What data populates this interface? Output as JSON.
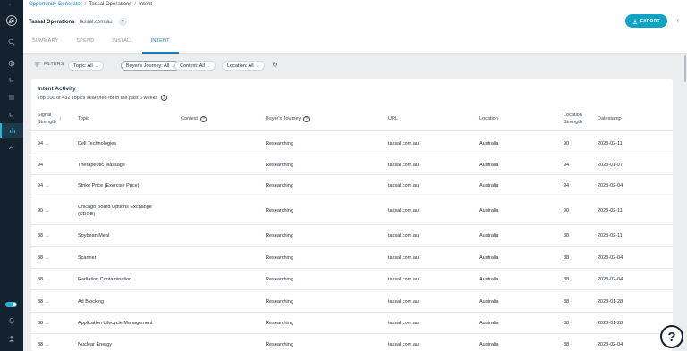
{
  "breadcrumb": {
    "root": "Opportunity Generator",
    "mid": "Tassal Operations",
    "current": "Intent"
  },
  "company": {
    "name": "Tassal Operations",
    "domain": "tassal.com.au",
    "help": "?"
  },
  "export_label": "EXPORT",
  "tabs": [
    {
      "label": "SUMMARY",
      "active": false
    },
    {
      "label": "SPEND",
      "active": false
    },
    {
      "label": "INSTALL",
      "active": false
    },
    {
      "label": "INTENT",
      "active": true
    }
  ],
  "filters": {
    "label": "FILTERS",
    "topic": "Topic: All",
    "journey": "Buyer's Journey: All",
    "context": "Context: All",
    "location": "Location: All"
  },
  "intent": {
    "title": "Intent Activity",
    "subtitle": "Top 100 of 432 Topics searched for in the past 6 weeks",
    "columns": {
      "signal": "Signal\nStrength",
      "topic": "Topic",
      "context": "Context",
      "journey": "Buyer's Journey",
      "url": "URL",
      "location": "Location",
      "loc_strength": "Location\nStrength",
      "date": "Datestamp"
    },
    "rows": [
      {
        "signal": "94",
        "arrow": "→",
        "topic": "Dell Technologies",
        "context": "",
        "journey": "Researching",
        "url": "tassal.com.au",
        "location": "Australia",
        "loc_strength": "90",
        "date": "2023-02-11"
      },
      {
        "signal": "94",
        "arrow": "",
        "topic": "Therapeutic Massage",
        "context": "",
        "journey": "Researching",
        "url": "tassal.com.au",
        "location": "Australia",
        "loc_strength": "94",
        "date": "2023-01-07"
      },
      {
        "signal": "94",
        "arrow": "→",
        "topic": "Strike Price (Exercise Price)",
        "context": "",
        "journey": "Researching",
        "url": "tassal.com.au",
        "location": "Australia",
        "loc_strength": "94",
        "date": "2023-02-04"
      },
      {
        "signal": "90",
        "arrow": "→",
        "topic": "Chicago Board Options Exchange\n(CBOE)",
        "context": "",
        "journey": "Researching",
        "url": "tassal.com.au",
        "location": "Australia",
        "loc_strength": "90",
        "date": "2023-02-11"
      },
      {
        "signal": "88",
        "arrow": "→",
        "topic": "Soybean Meal",
        "context": "",
        "journey": "Researching",
        "url": "tassal.com.au",
        "location": "Australia",
        "loc_strength": "88",
        "date": "2023-02-11"
      },
      {
        "signal": "88",
        "arrow": "→",
        "topic": "Scanner",
        "context": "",
        "journey": "Researching",
        "url": "tassal.com.au",
        "location": "Australia",
        "loc_strength": "88",
        "date": "2023-02-04"
      },
      {
        "signal": "88",
        "arrow": "→",
        "topic": "Radiation Contamination",
        "context": "",
        "journey": "Researching",
        "url": "tassal.com.au",
        "location": "Australia",
        "loc_strength": "88",
        "date": "2023-02-04"
      },
      {
        "signal": "88",
        "arrow": "→",
        "topic": "Ad Blocking",
        "context": "",
        "journey": "Researching",
        "url": "tassal.com.au",
        "location": "Australia",
        "loc_strength": "88",
        "date": "2023-01-28"
      },
      {
        "signal": "88",
        "arrow": "→",
        "topic": "Application Lifecycle Management",
        "context": "",
        "journey": "Researching",
        "url": "tassal.com.au",
        "location": "Australia",
        "loc_strength": "88",
        "date": "2023-01-28"
      },
      {
        "signal": "88",
        "arrow": "→",
        "topic": "Nuclear Energy",
        "context": "",
        "journey": "Researching",
        "url": "tassal.com.au",
        "location": "Australia",
        "loc_strength": "88",
        "date": "2023-02-04"
      }
    ]
  },
  "help_fab": "?",
  "colors": {
    "accent": "#0fa3c5",
    "sidebar": "#14212e",
    "link": "#1581b8"
  }
}
